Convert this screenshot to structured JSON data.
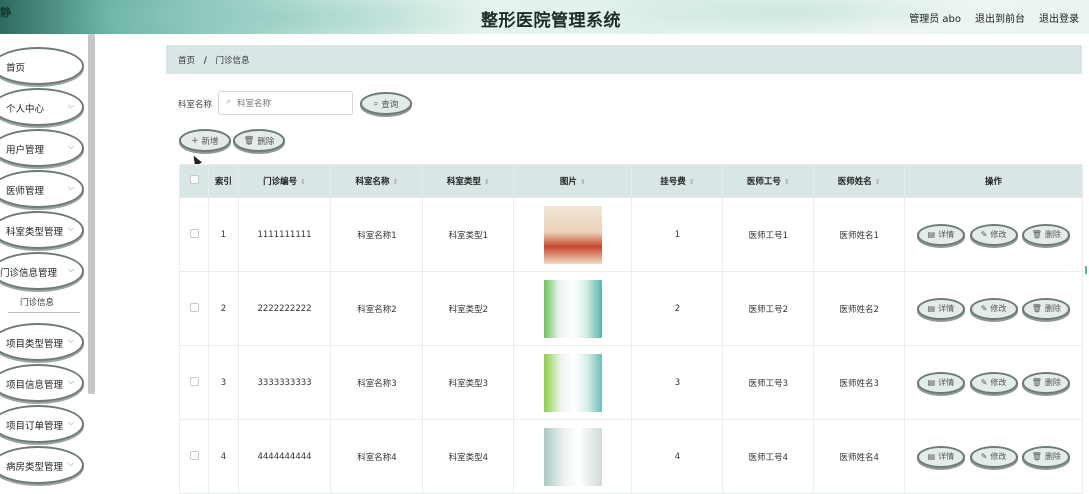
{
  "header": {
    "logo_text": "静",
    "title": "整形医院管理系统",
    "user_label": "管理员 abo",
    "back_link": "退出到前台",
    "logout_link": "退出登录"
  },
  "sidebar": {
    "items": [
      {
        "label": "首页"
      },
      {
        "label": "个人中心"
      },
      {
        "label": "用户管理"
      },
      {
        "label": "医师管理"
      },
      {
        "label": "科室类型管理"
      },
      {
        "label": "门诊信息管理"
      },
      {
        "label": "项目类型管理"
      },
      {
        "label": "项目信息管理"
      },
      {
        "label": "项目订单管理"
      },
      {
        "label": "病房类型管理"
      }
    ],
    "submenu_label": "门诊信息"
  },
  "breadcrumb": {
    "home": "首页",
    "separator": "/",
    "current": "门诊信息"
  },
  "search": {
    "label": "科室名称",
    "placeholder": "科室名称",
    "query_button": "查询"
  },
  "toolbar": {
    "add_button": "新增",
    "delete_button": "删除"
  },
  "table": {
    "headers": {
      "index": "索引",
      "clinic_no": "门诊编号",
      "dept_name": "科室名称",
      "dept_type": "科室类型",
      "image": "图片",
      "fee": "挂号费",
      "doctor_id": "医师工号",
      "doctor_name": "医师姓名",
      "actions": "操作"
    },
    "rows": [
      {
        "index": "1",
        "clinic_no": "1111111111",
        "dept_name": "科室名称1",
        "dept_type": "科室类型1",
        "fee": "1",
        "doctor_id": "医师工号1",
        "doctor_name": "医师姓名1"
      },
      {
        "index": "2",
        "clinic_no": "2222222222",
        "dept_name": "科室名称2",
        "dept_type": "科室类型2",
        "fee": "2",
        "doctor_id": "医师工号2",
        "doctor_name": "医师姓名2"
      },
      {
        "index": "3",
        "clinic_no": "3333333333",
        "dept_name": "科室名称3",
        "dept_type": "科室类型3",
        "fee": "3",
        "doctor_id": "医师工号3",
        "doctor_name": "医师姓名3"
      },
      {
        "index": "4",
        "clinic_no": "4444444444",
        "dept_name": "科室名称4",
        "dept_type": "科室类型4",
        "fee": "4",
        "doctor_id": "医师工号4",
        "doctor_name": "医师姓名4"
      }
    ],
    "action_labels": {
      "detail": "详情",
      "edit": "修改",
      "delete": "删除"
    }
  },
  "icons": {
    "sort": "sort-icon",
    "search": "search-icon",
    "add": "plus-icon",
    "delete": "trash-icon",
    "detail": "document-icon",
    "edit": "pencil-icon",
    "chevron": "chevron-down-icon"
  },
  "colors": {
    "accent": "#d8e7e6",
    "pill_fill": "#e4ecea",
    "pill_border": "#6e7a78"
  }
}
